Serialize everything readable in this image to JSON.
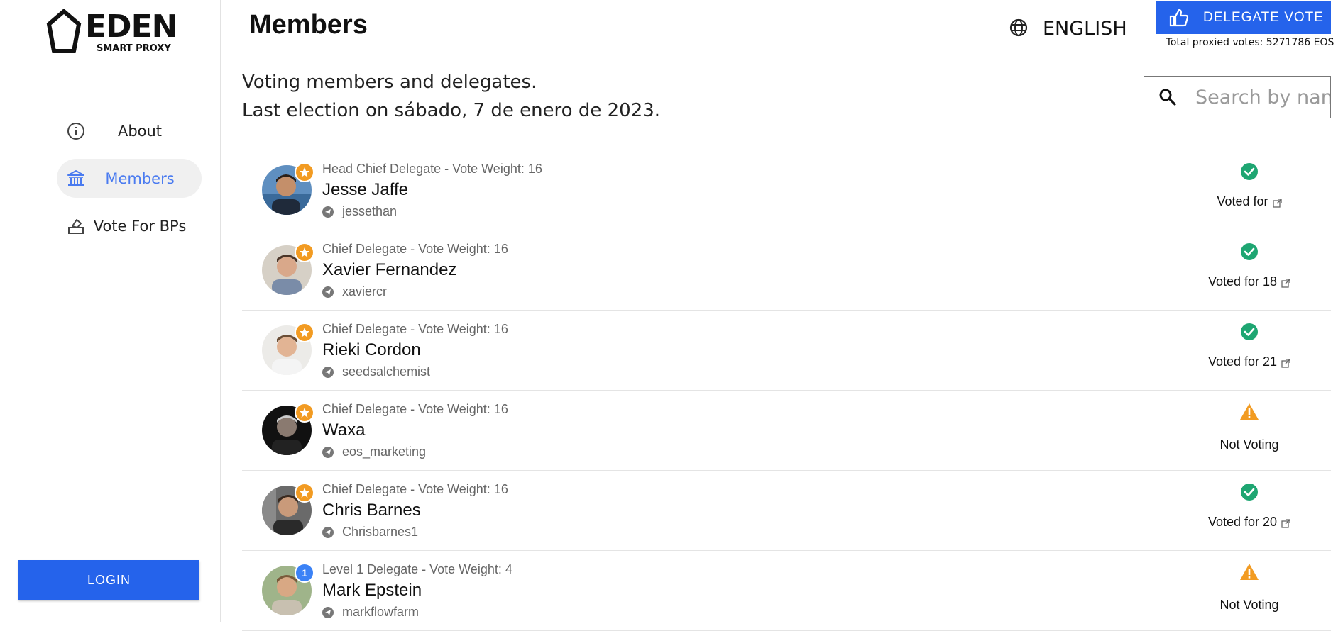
{
  "logo": {
    "word": "EDEN",
    "sub": "SMART PROXY"
  },
  "sidebar": {
    "items": [
      {
        "label": "About",
        "icon": "info-icon",
        "active": false
      },
      {
        "label": "Members",
        "icon": "bank-icon",
        "active": true
      },
      {
        "label": "Vote For BPs",
        "icon": "ballot-icon",
        "active": false
      }
    ],
    "login_label": "LOGIN"
  },
  "header": {
    "title": "Members",
    "language": "ENGLISH",
    "delegate_label": "DELEGATE VOTE",
    "proxied_votes": "Total proxied votes: 5271786 EOS"
  },
  "intro": {
    "line1": "Voting members and delegates.",
    "line2": "Last election on sábado, 7 de enero de 2023."
  },
  "search": {
    "placeholder": "Search by name"
  },
  "colors": {
    "accent": "#2563eb",
    "voted": "#1ea672",
    "warning": "#f29b22"
  },
  "members": [
    {
      "role": "Head Chief Delegate",
      "weight": " - Vote Weight: 16",
      "name": "Jesse Jaffe",
      "handle": "jessethan",
      "badge": "star",
      "status": "voted",
      "status_text": "Voted for",
      "link": true
    },
    {
      "role": "Chief Delegate",
      "weight": " - Vote Weight: 16",
      "name": "Xavier Fernandez",
      "handle": "xaviercr",
      "badge": "star",
      "status": "voted",
      "status_text": "Voted for 18",
      "link": true
    },
    {
      "role": "Chief Delegate",
      "weight": " - Vote Weight: 16",
      "name": "Rieki Cordon",
      "handle": "seedsalchemist",
      "badge": "star",
      "status": "voted",
      "status_text": "Voted for 21",
      "link": true
    },
    {
      "role": "Chief Delegate",
      "weight": " - Vote Weight: 16",
      "name": "Waxa",
      "handle": "eos_marketing",
      "badge": "star",
      "status": "warning",
      "status_text": "Not Voting",
      "link": false
    },
    {
      "role": "Chief Delegate",
      "weight": " - Vote Weight: 16",
      "name": "Chris Barnes",
      "handle": "Chrisbarnes1",
      "badge": "star",
      "status": "voted",
      "status_text": "Voted for 20",
      "link": true
    },
    {
      "role": "Level 1 Delegate",
      "weight": " - Vote Weight: 4",
      "name": "Mark Epstein",
      "handle": "markflowfarm",
      "badge": "level",
      "badge_text": "1",
      "status": "warning",
      "status_text": "Not Voting",
      "link": false
    }
  ]
}
